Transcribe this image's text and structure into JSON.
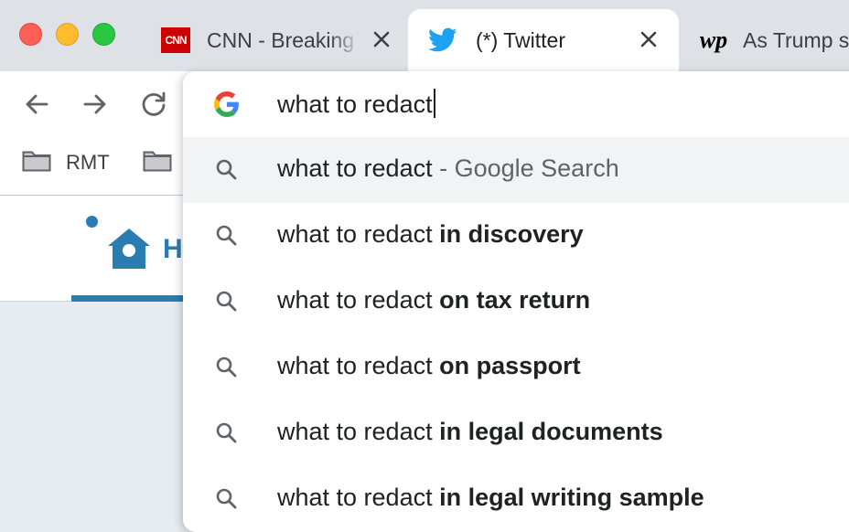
{
  "tabs": [
    {
      "title": "CNN - Breaking",
      "favicon": "cnn-logo",
      "logo_text": "CNN"
    },
    {
      "title": "(*) Twitter",
      "favicon": "twitter-bird-icon",
      "active": true
    },
    {
      "title": "As Trump s",
      "favicon": "washington-post-logo",
      "logo_text": "wp"
    }
  ],
  "bookmarks": [
    {
      "label": "RMT",
      "icon": "folder-icon"
    },
    {
      "label": "",
      "icon": "folder-icon"
    }
  ],
  "page": {
    "home_label_partial": "H",
    "accent_color": "#2a7db1"
  },
  "omnibox": {
    "input_value": "what to redact",
    "suggestions": [
      {
        "prefix": "what to redact",
        "suffix": "Google Search",
        "separator": " - ",
        "selected": true
      },
      {
        "prefix": "what to redact",
        "completion": "in discovery"
      },
      {
        "prefix": "what to redact",
        "completion": "on tax return"
      },
      {
        "prefix": "what to redact",
        "completion": "on passport"
      },
      {
        "prefix": "what to redact",
        "completion": "in legal documents"
      },
      {
        "prefix": "what to redact",
        "completion": "in legal writing sample"
      }
    ]
  }
}
